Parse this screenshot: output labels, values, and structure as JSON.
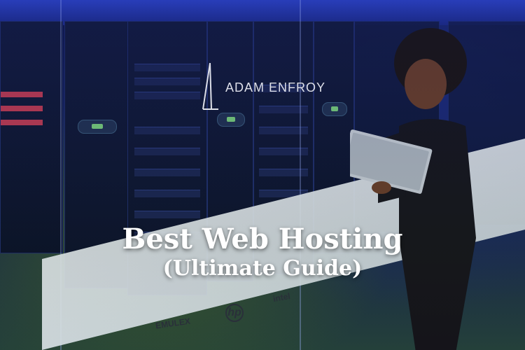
{
  "brand": {
    "name": "ADAM ENFROY"
  },
  "headline": {
    "line1": "Best Web Hosting",
    "line2": "(Ultimate Guide)"
  },
  "floor_logos": {
    "hp": "hp",
    "intel": "intel",
    "emulex": "EMULEX"
  },
  "colors": {
    "ceiling": "#2d44c8",
    "text": "#ffffff",
    "floor": "#e6ecf0"
  },
  "icons": [
    "adam-enfroy-logo-icon",
    "laptop-icon"
  ]
}
